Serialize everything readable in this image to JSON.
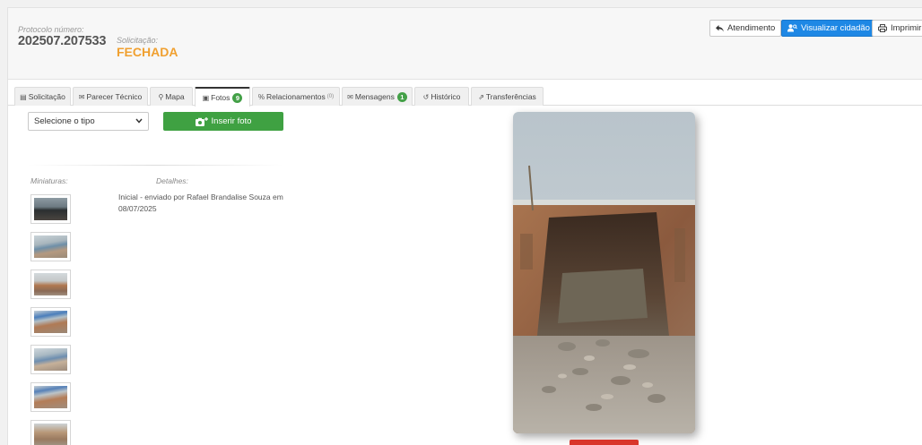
{
  "header": {
    "protocol_label": "Protocolo número:",
    "protocol_number": "202507.207533",
    "request_label": "Solicitação:",
    "request_status": "FECHADA",
    "buttons": {
      "atendimento": "Atendimento",
      "visualizar": "Visualizar cidadão",
      "imprimir": "Imprimir"
    }
  },
  "tabs": [
    {
      "label": "Solicitação",
      "icon": "file-icon"
    },
    {
      "label": "Parecer Técnico",
      "icon": "chat-icon"
    },
    {
      "label": "Mapa",
      "icon": "map-marker-icon"
    },
    {
      "label": "Fotos",
      "icon": "image-icon",
      "badge": "9"
    },
    {
      "label": "Relacionamentos",
      "icon": "link-icon",
      "badge": "(0)"
    },
    {
      "label": "Mensagens",
      "icon": "envelope-icon",
      "badge": "1"
    },
    {
      "label": "Histórico",
      "icon": "history-icon"
    },
    {
      "label": "Transferências",
      "icon": "share-icon"
    }
  ],
  "active_tab": "Fotos",
  "photos_panel": {
    "type_select": "Selecione o tipo",
    "insert_button": "Inserir foto",
    "thumbnails_label": "Miniaturas:",
    "details_label": "Detalhes:",
    "details_text": "Inicial - enviado por Rafael Brandalise Souza em 08/07/2025"
  },
  "colors": {
    "accent_blue": "#1e88e5",
    "green": "#3fa142",
    "status_orange": "#f0a030",
    "delete_red": "#d9362b"
  }
}
